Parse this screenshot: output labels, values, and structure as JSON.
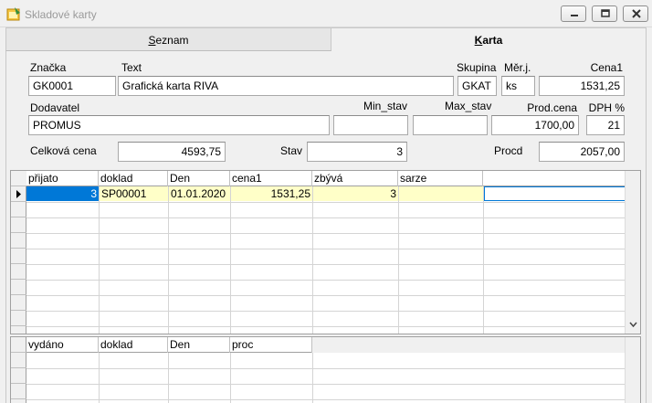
{
  "window": {
    "title": "Skladové karty"
  },
  "tabs": [
    {
      "label": "Seznam"
    },
    {
      "label": "Karta"
    }
  ],
  "form": {
    "znacka": {
      "label": "Značka",
      "value": "GK0001"
    },
    "text": {
      "label": "Text",
      "value": "Grafická karta RIVA"
    },
    "skupina": {
      "label": "Skupina",
      "value": "GKAT"
    },
    "merj": {
      "label": "Měr.j.",
      "value": "ks"
    },
    "cena1": {
      "label": "Cena1",
      "value": "1531,25"
    },
    "dodavatel": {
      "label": "Dodavatel",
      "value": "PROMUS"
    },
    "min_stav": {
      "label": "Min_stav",
      "value": ""
    },
    "max_stav": {
      "label": "Max_stav",
      "value": ""
    },
    "prod_cena": {
      "label": "Prod.cena",
      "value": "1700,00"
    },
    "dph": {
      "label": "DPH %",
      "value": "21"
    },
    "celkova_cena": {
      "label": "Celková cena",
      "value": "4593,75"
    },
    "stav": {
      "label": "Stav",
      "value": "3"
    },
    "procd": {
      "label": "Procd",
      "value": "2057,00"
    }
  },
  "grid_in": {
    "columns": [
      "přijato",
      "doklad",
      "Den",
      "cena1",
      "zbývá",
      "sarze"
    ],
    "rows": [
      {
        "prijato": "3",
        "doklad": "SP00001",
        "den": "01.01.2020",
        "cena1": "1531,25",
        "zbyva": "3",
        "sarze": ""
      }
    ]
  },
  "grid_out": {
    "columns": [
      "vydáno",
      "doklad",
      "Den",
      "proc"
    ]
  },
  "colors": {
    "selected_cell": "#0078d7",
    "row_highlight": "#ffffc8",
    "title_text": "#9a9a9a"
  }
}
